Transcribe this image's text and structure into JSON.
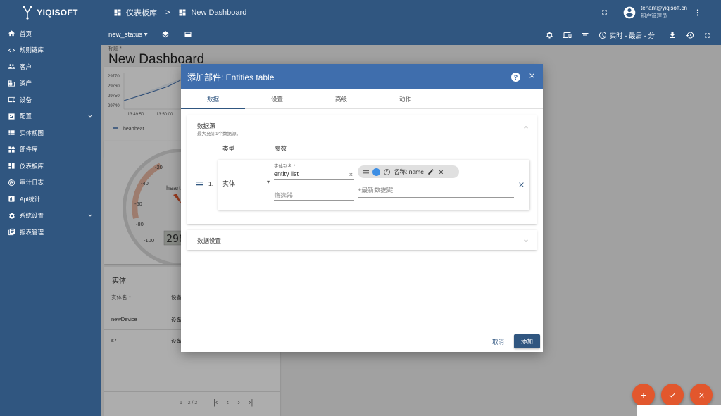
{
  "brand": {
    "name": "YIQISOFT"
  },
  "sidebar": {
    "items": [
      {
        "label": "首页",
        "icon": "home-icon"
      },
      {
        "label": "规则链库",
        "icon": "code-icon"
      },
      {
        "label": "客户",
        "icon": "people-icon"
      },
      {
        "label": "资产",
        "icon": "domain-icon"
      },
      {
        "label": "设备",
        "icon": "devices-icon"
      },
      {
        "label": "配置",
        "icon": "settings-panel-icon",
        "expandable": true
      },
      {
        "label": "实体视图",
        "icon": "view-list-icon"
      },
      {
        "label": "部件库",
        "icon": "widgets-icon"
      },
      {
        "label": "仪表板库",
        "icon": "dashboard-icon"
      },
      {
        "label": "审计日志",
        "icon": "track-changes-icon"
      },
      {
        "label": "Api统计",
        "icon": "bar-chart-icon"
      },
      {
        "label": "系统设置",
        "icon": "gear-icon",
        "expandable": true
      },
      {
        "label": "报表管理",
        "icon": "report-icon"
      }
    ]
  },
  "header": {
    "breadcrumb_root": "仪表板库",
    "breadcrumb_sep": ">",
    "breadcrumb_current": "New Dashboard",
    "user_email": "tenant@yiqisoft.cn",
    "user_role": "租户管理员",
    "state_select": "new_status",
    "timewindow": "实时 - 最后 - 分"
  },
  "dashboard": {
    "title_label": "标题 *",
    "title": "New Dashboard",
    "timeseries": {
      "y_ticks": [
        "29770",
        "29760",
        "29750",
        "29740"
      ],
      "x_ticks": [
        "13:49:50",
        "13:50:00"
      ],
      "legend": "heartbeat"
    },
    "gauge": {
      "ticks": [
        "-20",
        "-40",
        "-60",
        "-80",
        "-100"
      ],
      "label": "heart",
      "value": "298"
    },
    "entities": {
      "title": "实体",
      "col_name": "实体名 ↑",
      "col_type": "设备",
      "rows": [
        {
          "name": "newDevice",
          "type": "设备"
        },
        {
          "name": "s7",
          "type": "设备"
        }
      ],
      "pagination": "1 – 2 / 2"
    }
  },
  "dialog": {
    "title": "添加部件: Entities table",
    "tabs": [
      "数据",
      "设置",
      "高级",
      "动作"
    ],
    "active_tab": 0,
    "datasources": {
      "title": "数据源",
      "subtitle": "最大允许1个数据源。",
      "col_type": "类型",
      "col_params": "参数",
      "row": {
        "index": "1.",
        "type": "实体",
        "alias_label": "实体别名 *",
        "alias_value": "entity list",
        "filter_placeholder": "筛选器",
        "chip_icon_letter": "E",
        "chip_label": "名称: name",
        "latest_key_placeholder": "+最新数据键"
      }
    },
    "data_settings": "数据设置",
    "cancel": "取消",
    "add": "添加"
  },
  "colors": {
    "primary": "#305680",
    "dialog_header": "#3f6ead",
    "fab": "#e2572d",
    "chip_dot": "#3d8ee4"
  }
}
